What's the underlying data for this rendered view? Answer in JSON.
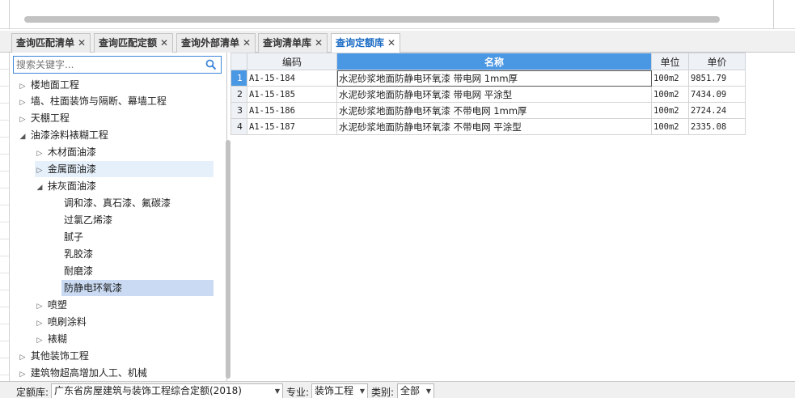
{
  "tabs": [
    {
      "label": "查询匹配清单",
      "close": "✕"
    },
    {
      "label": "查询匹配定额",
      "close": "✕"
    },
    {
      "label": "查询外部清单",
      "close": "✕"
    },
    {
      "label": "查询清单库",
      "close": "✕"
    },
    {
      "label": "查询定额库",
      "close": "✕"
    }
  ],
  "search": {
    "placeholder": "搜索关键字..."
  },
  "tree": [
    {
      "label": "楼地面工程",
      "arrow": "▷"
    },
    {
      "label": "墙、柱面装饰与隔断、幕墙工程",
      "arrow": "▷"
    },
    {
      "label": "天棚工程",
      "arrow": "▷"
    },
    {
      "label": "油漆涂料裱糊工程",
      "arrow": "◢"
    },
    {
      "label": "木材面油漆",
      "arrow": "▷"
    },
    {
      "label": "金属面油漆",
      "arrow": "▷"
    },
    {
      "label": "抹灰面油漆",
      "arrow": "◢"
    },
    {
      "label": "调和漆、真石漆、氟碳漆",
      "arrow": ""
    },
    {
      "label": "过氯乙烯漆",
      "arrow": ""
    },
    {
      "label": "腻子",
      "arrow": ""
    },
    {
      "label": "乳胶漆",
      "arrow": ""
    },
    {
      "label": "耐磨漆",
      "arrow": ""
    },
    {
      "label": "防静电环氧漆",
      "arrow": ""
    },
    {
      "label": "喷塑",
      "arrow": "▷"
    },
    {
      "label": "喷刷涂料",
      "arrow": "▷"
    },
    {
      "label": "裱糊",
      "arrow": "▷"
    },
    {
      "label": "其他装饰工程",
      "arrow": "▷"
    },
    {
      "label": "建筑物超高增加人工、机械",
      "arrow": "▷"
    }
  ],
  "table": {
    "headers": {
      "code": "编码",
      "name": "名称",
      "unit": "单位",
      "price": "单价"
    },
    "rows": [
      {
        "idx": "1",
        "code": "A1-15-184",
        "name": "水泥砂浆地面防静电环氧漆 带电网 1mm厚",
        "unit": "100m2",
        "price": "9851.79"
      },
      {
        "idx": "2",
        "code": "A1-15-185",
        "name": "水泥砂浆地面防静电环氧漆 带电网 平涂型",
        "unit": "100m2",
        "price": "7434.09"
      },
      {
        "idx": "3",
        "code": "A1-15-186",
        "name": "水泥砂浆地面防静电环氧漆 不带电网 1mm厚",
        "unit": "100m2",
        "price": "2724.24"
      },
      {
        "idx": "4",
        "code": "A1-15-187",
        "name": "水泥砂浆地面防静电环氧漆 不带电网 平涂型",
        "unit": "100m2",
        "price": "2335.08"
      }
    ]
  },
  "bottom": {
    "library_label": "定额库:",
    "library_value": "广东省房屋建筑与装饰工程综合定额(2018)",
    "major_label": "专业:",
    "major_value": "装饰工程",
    "category_label": "类别:",
    "category_value": "全部",
    "dropdown_glyph": "▼"
  },
  "colors": {
    "accent": "#4a97e4",
    "active_tab_text": "#1a6bc4",
    "selected_node": "#c9daf2"
  }
}
